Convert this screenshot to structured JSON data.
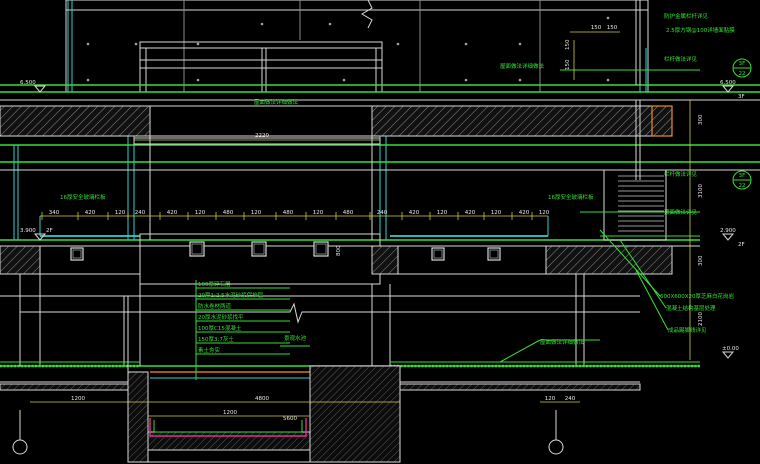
{
  "drawing": {
    "levels": {
      "top_left": "6.500",
      "top_right": "6.500",
      "mid_left": "3.900",
      "mid_right": "2.900",
      "ground": "±0.00"
    },
    "floors": {
      "f3": "3F",
      "f2": "2F"
    },
    "axis_bubbles": {
      "top": "22",
      "mid": "22"
    },
    "dims": {
      "span_top": "2220",
      "top_right_a": "150",
      "top_right_b": "150",
      "top_side_a": "150",
      "top_side_b": "150",
      "vert_a": "300",
      "vert_b": "3100",
      "vert_c": "300",
      "vert_d": "2100",
      "win_h": "800",
      "bottom_left": "1200",
      "bottom_mid": "4800",
      "pool_width": "5600",
      "pool_label": "1200",
      "bottom_r1": "120",
      "bottom_r2": "240",
      "row": [
        "340",
        "420",
        "120",
        "240",
        "420",
        "120",
        "480",
        "120",
        "480",
        "120",
        "480",
        "240",
        "420",
        "120",
        "420",
        "120",
        "420",
        "120"
      ]
    },
    "notes": {
      "r1": "防护金属栏杆详见",
      "r2": "2.5厚方钢@100详墙面贴膜",
      "r3": "栏杆做法详见",
      "r4": "栏杆做法详见",
      "r5": "顶面做法详见",
      "r6": "600X600X20厚芝麻白花岗岩",
      "r7": "混凝土结构基层处理",
      "r8": "成品踢脚线详见",
      "roof_note": "屋面做法详细做法",
      "glass_left": "16厚安全玻璃栏板",
      "glass_right": "16厚安全玻璃栏板",
      "wall_left": "屋面做法详细做法",
      "ground_note": "屋面做法详细做法",
      "pool_title": "景观水池",
      "layer1": "100厚碎石层",
      "layer2": "20厚1:2.5水泥砂浆保护层",
      "layer3": "防水卷材两道",
      "layer4": "20厚水泥砂浆找平",
      "layer5": "100厚C15混凝土",
      "layer6": "150厚3:7灰土",
      "layer7": "素土夯实"
    }
  }
}
